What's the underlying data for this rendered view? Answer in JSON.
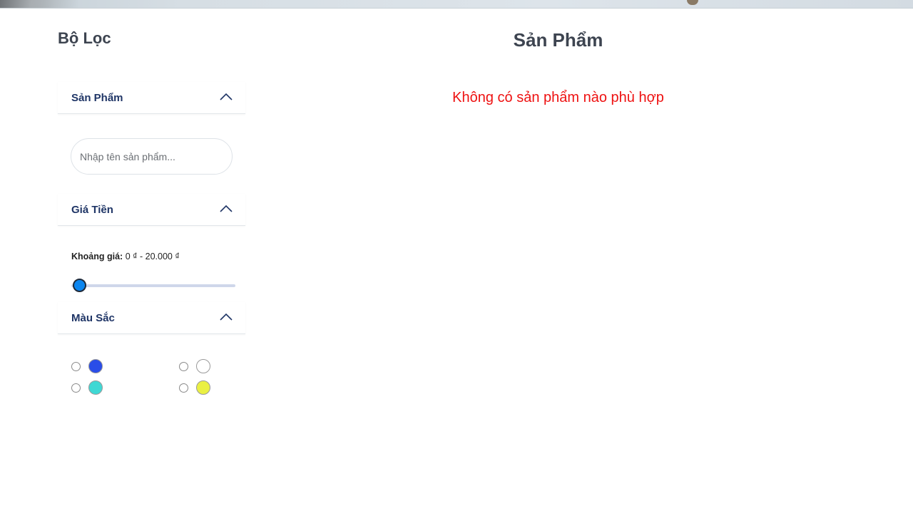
{
  "sidebar": {
    "title": "Bộ Lọc",
    "product_section": {
      "label": "Sản Phẩm",
      "search_placeholder": "Nhập tên sản phẩm...",
      "search_value": ""
    },
    "price_section": {
      "label": "Giá Tiền",
      "range_label": "Khoảng giá:",
      "range_value": "0 ₫ - 20.000 ₫",
      "slider_level": 0
    },
    "color_section": {
      "label": "Màu Sắc",
      "options": [
        {
          "color": "#2a4de8",
          "checked": false
        },
        {
          "color": "#ffffff",
          "checked": false
        },
        {
          "color": "#3fd8d4",
          "checked": false
        },
        {
          "color": "#eaf043",
          "checked": false
        }
      ]
    }
  },
  "main": {
    "title": "Sản Phẩm",
    "empty_message": "Không có sản phẩm nào phù hợp"
  },
  "icons": {
    "collapse": "chevron-up-icon"
  }
}
